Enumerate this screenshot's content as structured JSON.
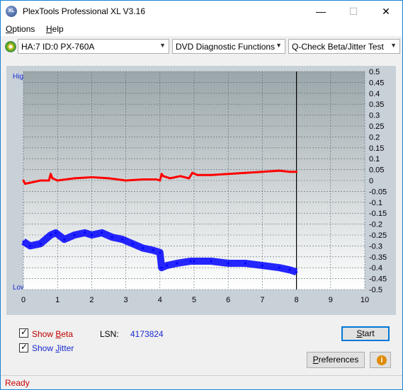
{
  "window": {
    "title": "PlexTools Professional XL V3.16",
    "app_icon_text": "XL",
    "minimize_glyph": "—",
    "maximize_glyph": "☐",
    "close_glyph": "✕"
  },
  "menu": {
    "options_first": "O",
    "options_rest": "ptions",
    "help_first": "H",
    "help_rest": "elp"
  },
  "toolbar": {
    "drive": "HA:7 ID:0  PX-760A",
    "function": "DVD Diagnostic Functions",
    "test": "Q-Check Beta/Jitter Test",
    "drive_icon": "disc-drive-icon",
    "dropdown_icon": "chevron-down-icon"
  },
  "chart_labels": {
    "high": "High",
    "low": "Low"
  },
  "chart_data": {
    "type": "line",
    "xlim": [
      0,
      10
    ],
    "ylim": [
      -0.5,
      0.5
    ],
    "x_ticks": [
      "0",
      "1",
      "2",
      "3",
      "4",
      "5",
      "6",
      "7",
      "8",
      "9",
      "10"
    ],
    "y_ticks": [
      "0.5",
      "0.45",
      "0.4",
      "0.35",
      "0.3",
      "0.25",
      "0.2",
      "0.15",
      "0.1",
      "0.05",
      "0",
      "-0.05",
      "-0.1",
      "-0.15",
      "-0.2",
      "-0.25",
      "-0.3",
      "-0.35",
      "-0.4",
      "-0.45",
      "-0.5"
    ],
    "grid": true,
    "end_marker_x": 8.0,
    "series": [
      {
        "name": "Beta",
        "color": "#ff0000",
        "x": [
          0,
          0.05,
          0.2,
          0.5,
          0.75,
          0.8,
          0.85,
          1.0,
          1.5,
          2.0,
          2.5,
          3.0,
          3.5,
          3.9,
          4.0,
          4.05,
          4.1,
          4.3,
          4.6,
          4.85,
          4.95,
          5.1,
          5.5,
          6.0,
          6.5,
          7.0,
          7.5,
          7.8,
          8.0
        ],
        "y": [
          0.0,
          -0.015,
          -0.01,
          0.0,
          0.0,
          0.03,
          0.01,
          0.0,
          0.01,
          0.015,
          0.01,
          0.0,
          0.005,
          0.005,
          0.0,
          0.03,
          0.02,
          0.01,
          0.02,
          0.01,
          0.035,
          0.025,
          0.025,
          0.03,
          0.035,
          0.04,
          0.045,
          0.04,
          0.04
        ]
      },
      {
        "name": "Jitter",
        "color": "#0000ff",
        "x": [
          0,
          0.2,
          0.5,
          0.8,
          0.95,
          1.2,
          1.5,
          1.8,
          2.0,
          2.3,
          2.6,
          2.9,
          3.2,
          3.5,
          3.8,
          4.0,
          4.05,
          4.2,
          4.5,
          4.9,
          5.0,
          5.5,
          6.0,
          6.5,
          7.0,
          7.5,
          7.8,
          8.0
        ],
        "y": [
          -0.28,
          -0.3,
          -0.29,
          -0.25,
          -0.24,
          -0.27,
          -0.25,
          -0.24,
          -0.25,
          -0.24,
          -0.26,
          -0.27,
          -0.29,
          -0.31,
          -0.32,
          -0.33,
          -0.4,
          -0.39,
          -0.38,
          -0.37,
          -0.37,
          -0.37,
          -0.38,
          -0.38,
          -0.39,
          -0.4,
          -0.41,
          -0.42
        ]
      }
    ]
  },
  "controls": {
    "show_beta_prefix": "Show ",
    "show_beta_u": "B",
    "show_beta_rest": "eta",
    "show_jitter_prefix": "Show ",
    "show_jitter_u": "J",
    "show_jitter_rest": "itter",
    "beta_color": "#c00000",
    "jitter_color": "#1a2ad0",
    "lsn_label": "LSN:",
    "lsn_value": "4173824",
    "start_u": "S",
    "start_rest": "tart",
    "preferences_u": "P",
    "preferences_rest": "references",
    "info_glyph": "i"
  },
  "status": {
    "text": "Ready"
  }
}
